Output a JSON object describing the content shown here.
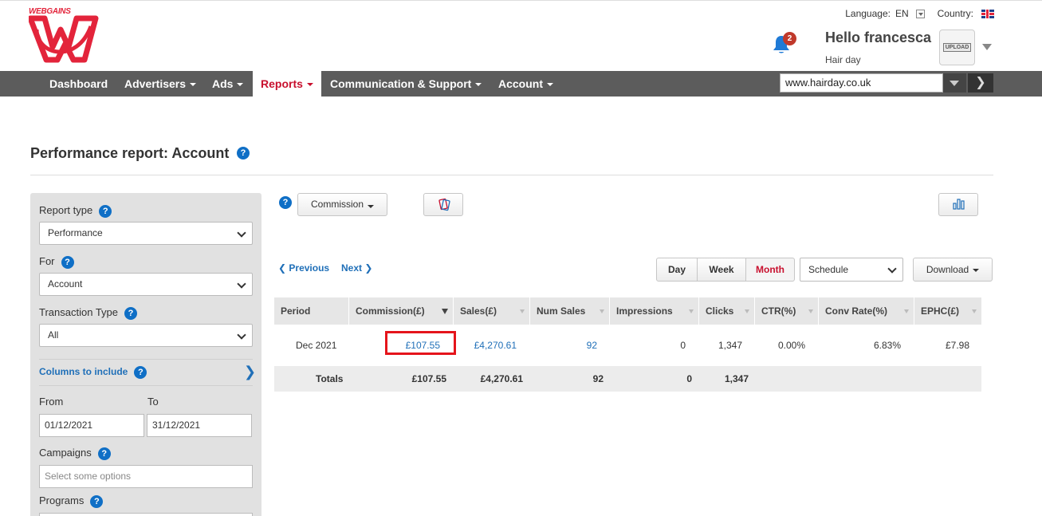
{
  "header": {
    "logo_text": "WEBGAINS",
    "language_label": "Language:",
    "language_value": "EN",
    "country_label": "Country:",
    "notification_count": "2",
    "greeting": "Hello francesca",
    "account_name": "Hair day",
    "avatar_text": "UPLOAD"
  },
  "nav": {
    "items": [
      {
        "label": "Dashboard"
      },
      {
        "label": "Advertisers"
      },
      {
        "label": "Ads"
      },
      {
        "label": "Reports"
      },
      {
        "label": "Communication & Support"
      },
      {
        "label": "Account"
      }
    ],
    "active": "Reports",
    "site_select_value": "www.hairday.co.uk",
    "go_icon": "chevron-right-icon"
  },
  "page": {
    "title": "Performance report: Account",
    "help_glyph": "?"
  },
  "sidebar": {
    "report_type_label": "Report type",
    "report_type_value": "Performance",
    "for_label": "For",
    "for_value": "Account",
    "transaction_type_label": "Transaction Type",
    "transaction_type_value": "All",
    "columns_label": "Columns to include",
    "from_label": "From",
    "to_label": "To",
    "from_value": "01/12/2021",
    "to_value": "31/12/2021",
    "campaigns_label": "Campaigns",
    "campaigns_placeholder": "Select some options",
    "programs_label": "Programs"
  },
  "toolbar": {
    "metric_button_label": "Commission",
    "prev_label": "❮ Previous",
    "next_label": "Next ❯",
    "period_buttons": [
      "Day",
      "Week",
      "Month"
    ],
    "active_period": "Month",
    "schedule_value": "Schedule",
    "download_label": "Download"
  },
  "table": {
    "columns": [
      "Period",
      "Commission(£)",
      "Sales(£)",
      "Num Sales",
      "Impressions",
      "Clicks",
      "CTR(%)",
      "Conv Rate(%)",
      "EPHC(£)"
    ],
    "sorted_column": "Commission(£)",
    "rows": [
      {
        "period": "Dec 2021",
        "commission": "£107.55",
        "sales": "£4,270.61",
        "num_sales": "92",
        "impressions": "0",
        "clicks": "1,347",
        "ctr": "0.00%",
        "conv_rate": "6.83%",
        "ephc": "£7.98"
      }
    ],
    "totals": {
      "label": "Totals",
      "commission": "£107.55",
      "sales": "£4,270.61",
      "num_sales": "92",
      "impressions": "0",
      "clicks": "1,347"
    }
  },
  "colors": {
    "brand_red": "#e3243b",
    "nav_bg": "#5c5c5c",
    "link_blue": "#1f6fb8",
    "highlight_red": "#e5141b"
  }
}
